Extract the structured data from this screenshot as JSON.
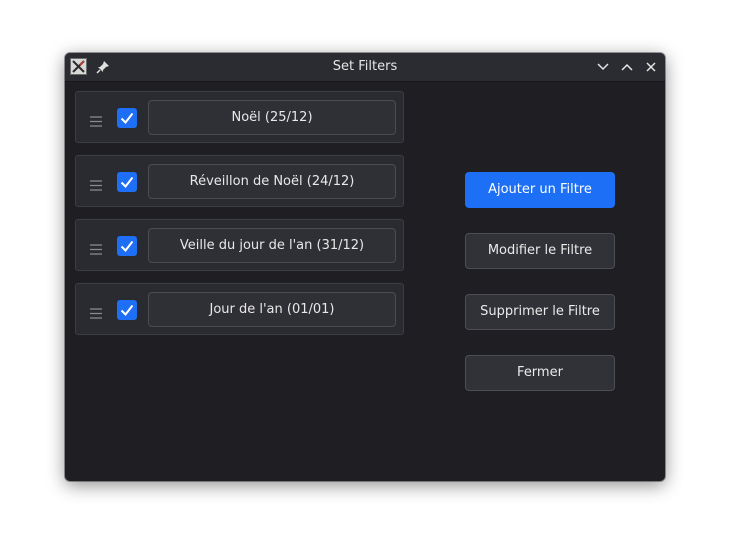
{
  "window": {
    "title": "Set Filters"
  },
  "filters": [
    {
      "label": "Noël (25/12)",
      "checked": true
    },
    {
      "label": "Réveillon de Noël (24/12)",
      "checked": true
    },
    {
      "label": "Veille du jour de l'an (31/12)",
      "checked": true
    },
    {
      "label": "Jour de l'an (01/01)",
      "checked": true
    }
  ],
  "actions": {
    "add": "Ajouter un Filtre",
    "edit": "Modifier le Filtre",
    "delete": "Supprimer le Filtre",
    "close": "Fermer"
  },
  "colors": {
    "accent": "#1d6ff6",
    "background": "#1f1f23",
    "card": "#2a2b30"
  },
  "icons": {
    "app": "x-app-icon",
    "pin": "pin-icon",
    "minimize": "chevron-down-icon",
    "maximize": "chevron-up-icon",
    "close": "close-icon",
    "drag": "drag-handle-icon",
    "check": "checkmark-icon"
  }
}
